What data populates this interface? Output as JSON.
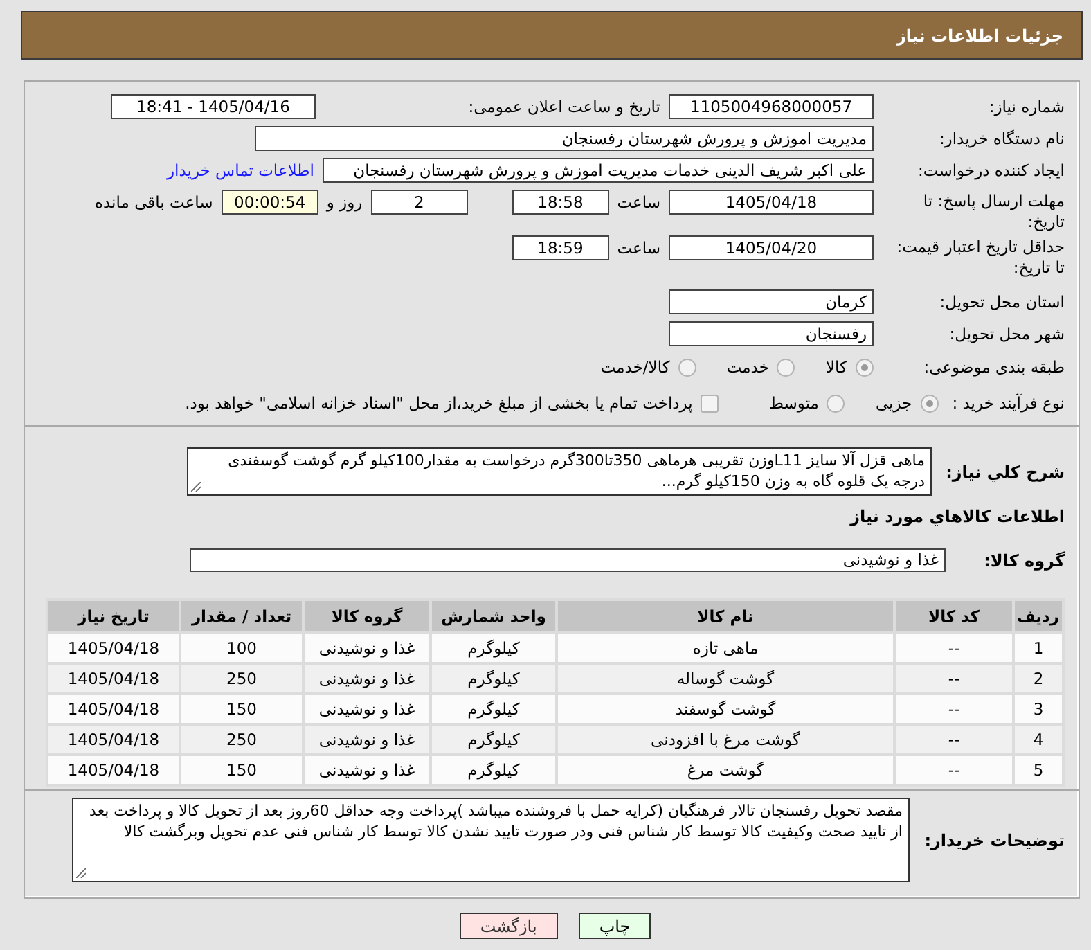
{
  "header": {
    "title": "جزئیات اطلاعات نیاز"
  },
  "need": {
    "number_label": "شماره نیاز:",
    "number": "1105004968000057",
    "announce_label": "تاریخ و ساعت اعلان عمومی:",
    "announce": "1405/04/16 - 18:41",
    "buyer_label": "نام دستگاه خریدار:",
    "buyer": "مدیریت اموزش و پرورش شهرستان رفسنجان",
    "requester_label": "ایجاد کننده درخواست:",
    "requester": "علی اکبر شریف الدینی خدمات مدیریت اموزش و پرورش شهرستان رفسنجان",
    "contact_link": "اطلاعات تماس خریدار"
  },
  "deadline": {
    "label": "مهلت ارسال پاسخ: تا تاریخ:",
    "date": "1405/04/18",
    "time_label": "ساعت",
    "time": "18:58",
    "days": "2",
    "days_label": "روز و",
    "remaining": "00:00:54",
    "remaining_label": "ساعت باقی مانده"
  },
  "price_validity": {
    "label": "حداقل تاریخ اعتبار قیمت: تا تاریخ:",
    "date": "1405/04/20",
    "time_label": "ساعت",
    "time": "18:59"
  },
  "delivery": {
    "province_label": "استان محل تحویل:",
    "province": "کرمان",
    "city_label": "شهر محل تحویل:",
    "city": "رفسنجان"
  },
  "category": {
    "label": "طبقه بندی موضوعی:",
    "options": [
      {
        "label": "کالا",
        "selected": true
      },
      {
        "label": "خدمت",
        "selected": false
      },
      {
        "label": "کالا/خدمت",
        "selected": false
      }
    ]
  },
  "purchase_type": {
    "label": "نوع فرآیند خرید :",
    "options": [
      {
        "label": "جزیی",
        "selected": true
      },
      {
        "label": "متوسط",
        "selected": false
      }
    ],
    "treasury_payment": {
      "checked": false,
      "text": "پرداخت تمام یا بخشی از مبلغ خرید،از محل \"اسناد خزانه اسلامی\" خواهد بود."
    }
  },
  "description": {
    "label": "شرح کلي نياز:",
    "value": "ماهی قزل آلا سایز L11وزن تقریبی هرماهی 350تا300گرم درخواست به مقدار100کیلو گرم گوشت گوسفندی درجه یک قلوه گاه به وزن 150کیلو گرم..."
  },
  "goods": {
    "title": "اطلاعات کالاهاي مورد نياز",
    "group_label": "گروه کالا:",
    "group": "غذا و نوشیدنی",
    "table": {
      "columns": [
        "ردیف",
        "کد کالا",
        "نام کالا",
        "واحد شمارش",
        "گروه کالا",
        "تعداد / مقدار",
        "تاریخ نیاز"
      ],
      "rows": [
        [
          "1",
          "--",
          "ماهی تازه",
          "کیلوگرم",
          "غذا و نوشیدنی",
          "100",
          "1405/04/18"
        ],
        [
          "2",
          "--",
          "گوشت گوساله",
          "کیلوگرم",
          "غذا و نوشیدنی",
          "250",
          "1405/04/18"
        ],
        [
          "3",
          "--",
          "گوشت گوسفند",
          "کیلوگرم",
          "غذا و نوشیدنی",
          "150",
          "1405/04/18"
        ],
        [
          "4",
          "--",
          "گوشت مرغ با افزودنی",
          "کیلوگرم",
          "غذا و نوشیدنی",
          "250",
          "1405/04/18"
        ],
        [
          "5",
          "--",
          "گوشت مرغ",
          "کیلوگرم",
          "غذا و نوشیدنی",
          "150",
          "1405/04/18"
        ]
      ]
    }
  },
  "buyer_notes": {
    "label": "توضیحات خریدار:",
    "value": "مقصد تحویل رفسنجان تالار فرهنگیان (کرایه حمل با فروشنده میباشد )پرداخت وجه حداقل 60روز بعد از تحویل کالا و پرداخت بعد از تایید صحت وکیفیت کالا توسط کار شناس فنی ودر صورت تایید نشدن کالا توسط کار شناس فنی عدم تحویل وبرگشت کالا"
  },
  "buttons": [
    {
      "label": "چاپ",
      "kind": "print"
    },
    {
      "label": "بازگشت",
      "kind": "back"
    }
  ]
}
